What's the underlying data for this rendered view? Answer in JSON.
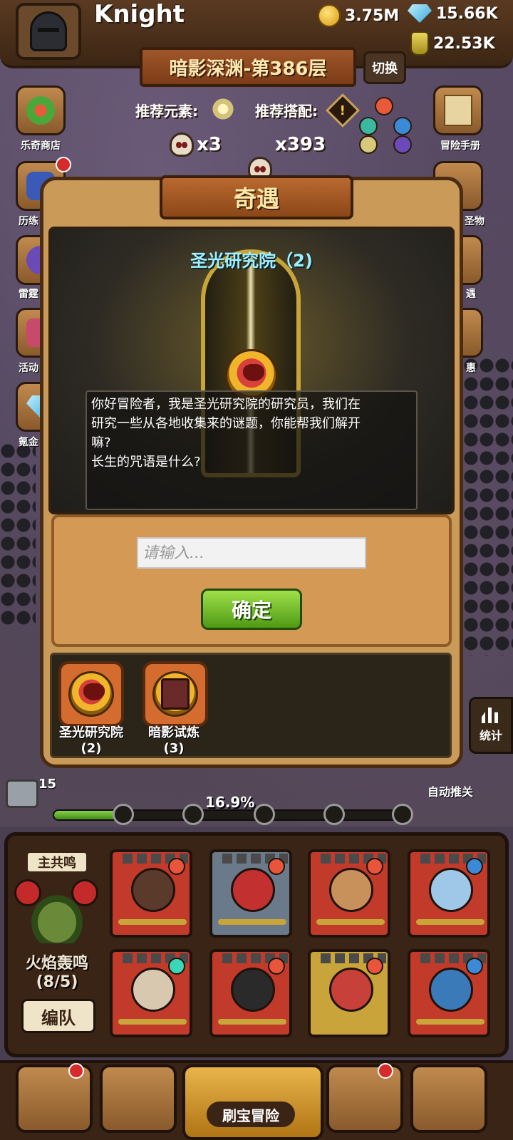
{
  "player": {
    "name": "Knight"
  },
  "resources": {
    "gold": "3.75M",
    "gems": "15.66K",
    "potions": "22.53K"
  },
  "floor": {
    "title": "暗影深渊-第386层",
    "switch_label": "切换"
  },
  "recommend": {
    "element_label": "推荐元素:",
    "combo_label": "推荐搭配:"
  },
  "enemies": {
    "elite_count": "x3",
    "normal_count": "x393"
  },
  "side_menu_left": [
    "乐奇商店",
    "历练",
    "雷霆",
    "活动",
    "氪金"
  ],
  "side_menu_right": [
    "冒险手册",
    "圣物",
    "遇",
    "惠"
  ],
  "dialog": {
    "title": "奇遇",
    "event_name": "圣光研究院（2)",
    "story_line1": "你好冒险者，我是圣光研究院的研究员，我们在",
    "story_line2": "研究一些从各地收集来的谜题，你能帮我们解开",
    "story_line3": "嘛?",
    "story_question": "长生的咒语是什么?",
    "input_placeholder": "请输入...",
    "confirm_label": "确定"
  },
  "event_list": [
    {
      "label": "圣光研究院",
      "count": "(2)",
      "icon": "holy-emblem-icon"
    },
    {
      "label": "暗影试炼",
      "count": "(3)",
      "icon": "shadow-book-icon"
    }
  ],
  "progress": {
    "percent_text": "16.9%",
    "fraction": 0.169,
    "chest_count": "15"
  },
  "auto_push": {
    "label": "自动推关",
    "state": "ON"
  },
  "stats_label": "统计",
  "team": {
    "resonance_tag": "主共鸣",
    "resonance_name": "火焰轰鸣",
    "resonance_count": "(8/5)",
    "edit_team_label": "编队",
    "heroes": [
      {
        "bg": "#c23a2a",
        "face": "#5a3a2a",
        "elem": "#e8553a"
      },
      {
        "bg": "#6a7a8a",
        "face": "#c23030",
        "elem": "#e8553a"
      },
      {
        "bg": "#c23a2a",
        "face": "#c8905a",
        "elem": "#e8553a"
      },
      {
        "bg": "#c23a2a",
        "face": "#9fc8e8",
        "elem": "#3a8ad8"
      },
      {
        "bg": "#c23a2a",
        "face": "#d8c8b0",
        "elem": "#3ad8b8"
      },
      {
        "bg": "#c23a2a",
        "face": "#2a2a2a",
        "elem": "#e8553a"
      },
      {
        "bg": "#c9a43a",
        "face": "#c8403a",
        "elem": "#e8553a"
      },
      {
        "bg": "#c23a2a",
        "face": "#3a7ab8",
        "elem": "#3a8ad8"
      }
    ]
  },
  "bottom_nav": {
    "main_label": "刷宝冒险"
  },
  "colors": {
    "accent_green": "#5fae2a",
    "dialog_bg": "#c99a58",
    "title_text": "#ffe9a6",
    "event_name": "#9ff0ff"
  }
}
